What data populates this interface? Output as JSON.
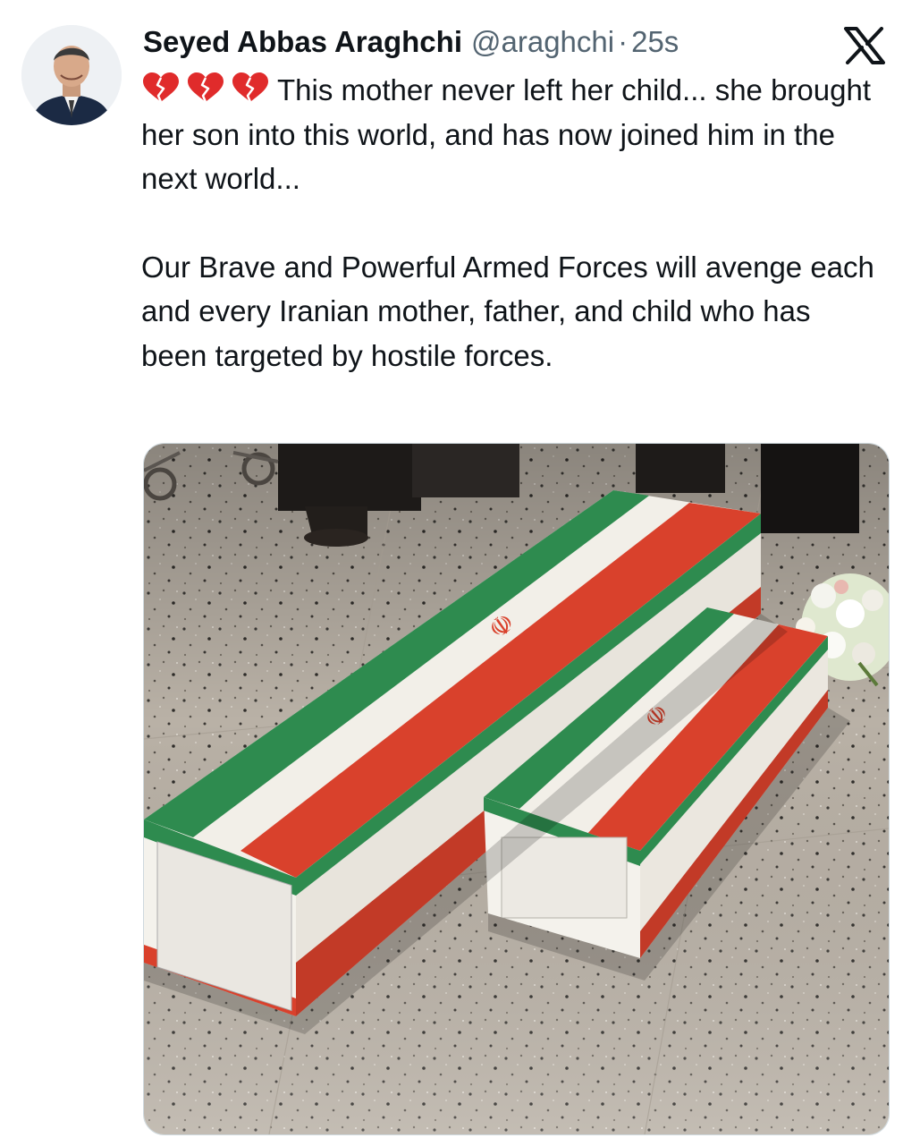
{
  "author": {
    "name": "Seyed Abbas Araghchi",
    "handle": "@araghchi",
    "separator": "·",
    "time": "25s"
  },
  "platform_icon": "x-logo-icon",
  "tweet": {
    "emoji_icons": [
      "broken-heart-icon",
      "broken-heart-icon",
      "broken-heart-icon"
    ],
    "paragraph1": "This mother never left her child... she brought her son into this world, and has now joined him in the next world...",
    "paragraph2": "Our Brave and Powerful Armed Forces will avenge each and every Iranian mother, father, and child who has been targeted by hostile forces."
  },
  "media": {
    "kind": "photo",
    "icon": "photo-coffins-flags"
  },
  "colors": {
    "text": "#0f1419",
    "secondary": "#536471",
    "flag_green": "#2e8b4f",
    "flag_red": "#d9412c"
  }
}
